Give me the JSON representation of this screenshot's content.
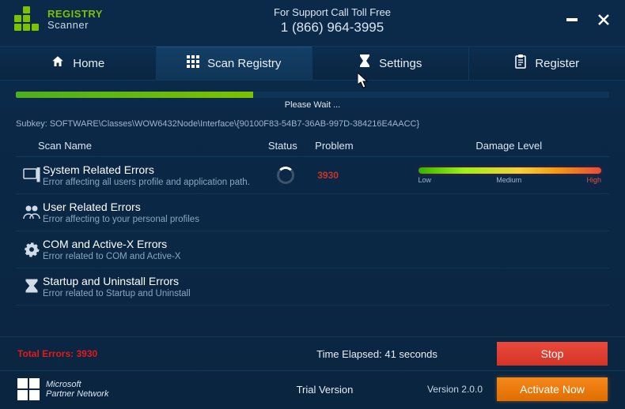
{
  "logo": {
    "line1": "REGISTRY",
    "line2": "Scanner"
  },
  "support": {
    "line1": "For Support Call Toll Free",
    "line2": "1 (866) 964-3995"
  },
  "tabs": [
    {
      "label": "Home"
    },
    {
      "label": "Scan Registry"
    },
    {
      "label": "Settings"
    },
    {
      "label": "Register"
    }
  ],
  "active_tab": 1,
  "progress": {
    "percent": 40,
    "wait_label": "Please Wait ..."
  },
  "subkey": {
    "prefix": "Subkey:",
    "path": "SOFTWARE\\Classes\\WOW6432Node\\Interface\\{90100F83-54B7-36AB-997D-384216E4AACC}"
  },
  "columns": {
    "scan_name": "Scan Name",
    "status": "Status",
    "problem": "Problem",
    "damage": "Damage Level"
  },
  "rows": [
    {
      "title": "System Related Errors",
      "desc": "Error affecting all users profile and application path.",
      "status": "scanning",
      "problem": "3930",
      "damage": true
    },
    {
      "title": "User Related Errors",
      "desc": "Error affecting to your personal profiles"
    },
    {
      "title": "COM and Active-X Errors",
      "desc": "Error related to COM and Active-X"
    },
    {
      "title": "Startup and Uninstall Errors",
      "desc": "Error related to Startup and Uninstall"
    }
  ],
  "damage_labels": {
    "low": "Low",
    "medium": "Medium",
    "high": "High"
  },
  "footer": {
    "total_errors_label": "Total Errors:",
    "total_errors_value": "3930",
    "time_elapsed_label": "Time Elapsed:",
    "time_elapsed_value": "41 seconds",
    "stop_label": "Stop",
    "ms_line1": "Microsoft",
    "ms_line2": "Partner Network",
    "trial_label": "Trial Version",
    "version_label": "Version 2.0.0",
    "activate_label": "Activate Now"
  }
}
